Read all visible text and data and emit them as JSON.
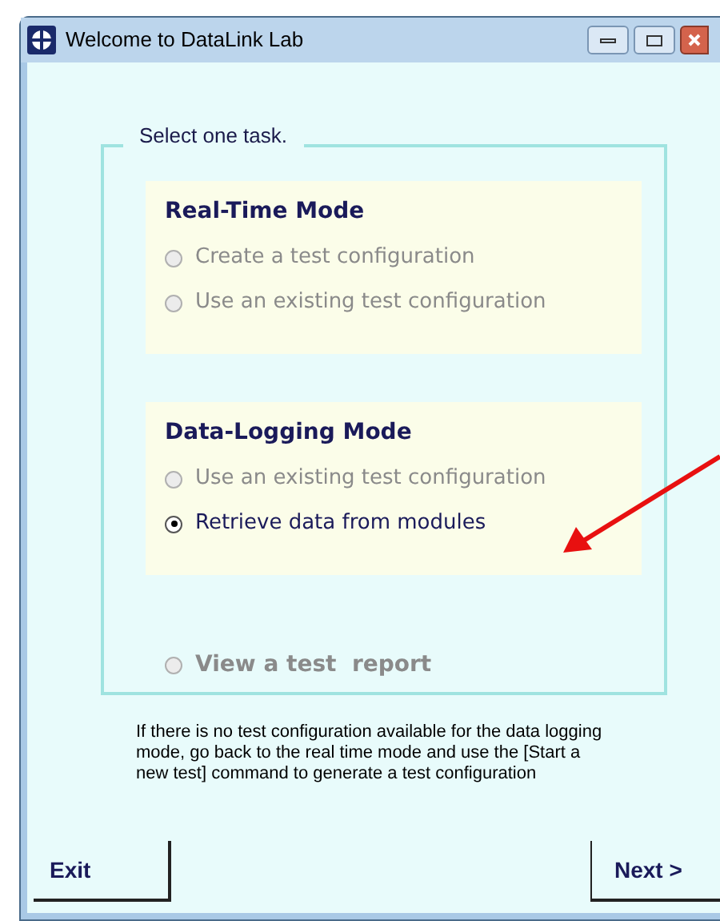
{
  "window": {
    "title": "Welcome to DataLink Lab"
  },
  "task_group": {
    "legend": "Select one task.",
    "modes": [
      {
        "heading": "Real-Time Mode",
        "options": [
          {
            "label": "Create a test configuration",
            "selected": false,
            "disabled": true
          },
          {
            "label": "Use an existing test configuration",
            "selected": false,
            "disabled": true
          }
        ]
      },
      {
        "heading": "Data-Logging Mode",
        "options": [
          {
            "label": "Use an existing test configuration",
            "selected": false,
            "disabled": true
          },
          {
            "label": "Retrieve data from modules",
            "selected": true,
            "disabled": false
          }
        ]
      }
    ],
    "report_option": {
      "label": "View a test  report",
      "selected": false,
      "disabled": true
    }
  },
  "note": "If there is no test configuration available for the data logging mode, go back to the real time mode and use the [Start a new test] command to generate a test configuration",
  "buttons": [
    {
      "label": "Exit"
    },
    {
      "label": "Next >"
    }
  ]
}
